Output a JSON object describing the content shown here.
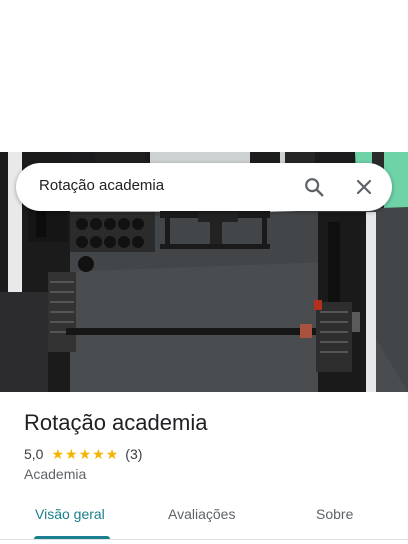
{
  "search": {
    "query": "Rotação academia"
  },
  "place": {
    "name": "Rotação academia",
    "rating": "5,0",
    "stars": 5,
    "review_count": "(3)",
    "category": "Academia"
  },
  "tabs": [
    {
      "label": "Visão geral",
      "active": true
    },
    {
      "label": "Avaliações",
      "active": false
    },
    {
      "label": "Sobre",
      "active": false
    }
  ],
  "colors": {
    "accent": "#1a7f8e",
    "star": "#f4b400",
    "wall": "#6fd3a8"
  },
  "icons": {
    "search": "search-icon",
    "close": "close-icon",
    "star": "star-icon"
  }
}
